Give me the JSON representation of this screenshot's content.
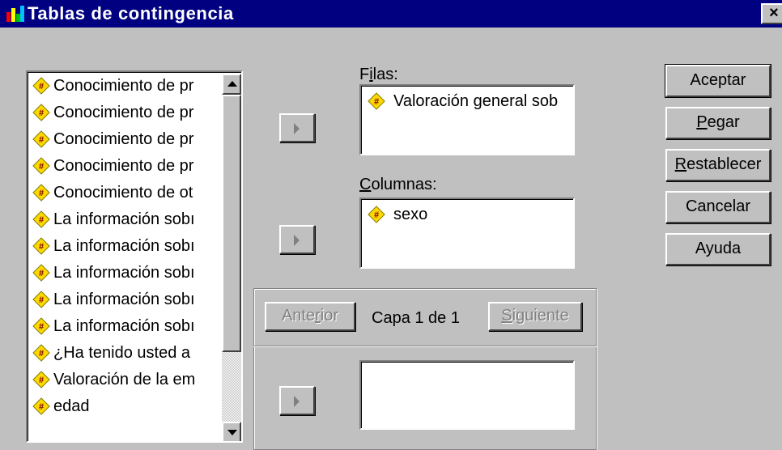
{
  "window": {
    "title": "Tablas de contingencia",
    "title_icon": "spss-crosstabs-icon",
    "close_label": "×"
  },
  "variable_list": {
    "item_icon": "numeric-variable-icon",
    "items": [
      "Conocimiento de pr",
      "Conocimiento de pr",
      "Conocimiento de pr",
      "Conocimiento de pr",
      "Conocimiento de ot",
      "La información sobı",
      "La información sobı",
      "La información sobı",
      "La información sobı",
      "La información sobı",
      "¿Ha tenido usted a",
      "Valoración de la em",
      "edad"
    ]
  },
  "rows": {
    "label_pre": "F",
    "label_ul": "i",
    "label_post": "las:",
    "item": "Valoración general sob"
  },
  "columns": {
    "label_pre": "",
    "label_ul": "C",
    "label_post": "olumnas:",
    "item": "sexo"
  },
  "layer": {
    "prev_pre": "Ante",
    "prev_ul": "r",
    "prev_post": "ior",
    "status": "Capa 1 de 1",
    "next_pre": "",
    "next_ul": "S",
    "next_post": "iguiente"
  },
  "buttons": {
    "ok": "Aceptar",
    "paste_ul": "P",
    "paste_rest": "egar",
    "reset_ul": "R",
    "reset_rest": "establecer",
    "cancel": "Cancelar",
    "help": "Ayuda"
  },
  "colors": {
    "titlebar": "#000080",
    "face": "#c0c0c0",
    "icon_yellow": "#ffd800"
  }
}
